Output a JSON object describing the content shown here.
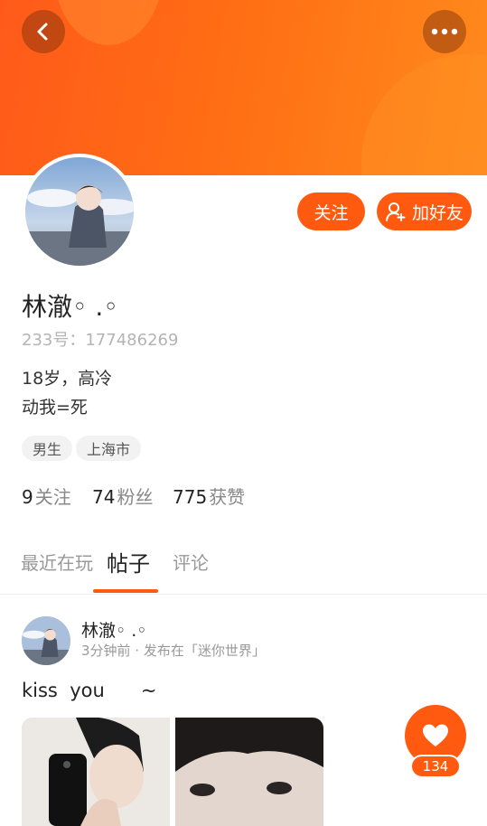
{
  "header": {
    "back_icon": "chevron-left-icon",
    "more_icon": "more-dots-icon"
  },
  "profile": {
    "name": "林澈◦ .◦",
    "uid": "233号：177486269",
    "bio": [
      "18岁，高冷",
      "动我=死"
    ],
    "tags": [
      "男生",
      "上海市"
    ],
    "stats": [
      {
        "num": "9",
        "label": "关注"
      },
      {
        "num": "74",
        "label": "粉丝"
      },
      {
        "num": "775",
        "label": "获赞"
      }
    ]
  },
  "actions": {
    "follow_label": "关注",
    "add_friend_label": "加好友",
    "add_friend_icon": "person-add-icon"
  },
  "tabs": [
    {
      "label": "最近在玩",
      "active": false
    },
    {
      "label": "帖子",
      "active": true
    },
    {
      "label": "评论",
      "active": false
    }
  ],
  "post": {
    "author": "林澈◦ .◦",
    "meta": "3分钟前 · 发布在「迷你世界」",
    "text": "kiss  you      ~",
    "like_count": "134",
    "like_icon": "heart-icon"
  },
  "colors": {
    "accent": "#ff5a0f",
    "banner": "#ff6d14"
  }
}
